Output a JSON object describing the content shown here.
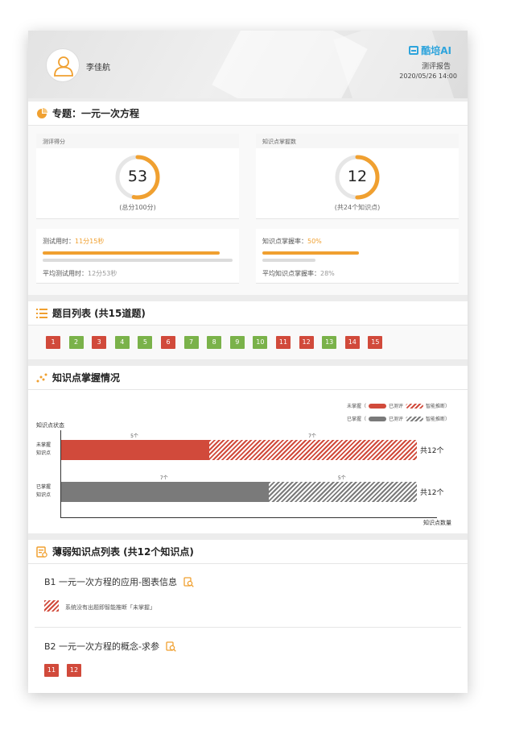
{
  "header": {
    "username": "李佳航",
    "brand": "酷培AI",
    "report_label": "测评报告",
    "report_time": "2020/05/26 14:00"
  },
  "topic": {
    "title": "专题：一元一次方程",
    "score_card": {
      "head": "测评得分",
      "value": "53",
      "sub": "(总分100分)",
      "fraction": 0.53
    },
    "kp_card": {
      "head": "知识点掌握数",
      "value": "12",
      "sub": "(共24个知识点)",
      "fraction": 0.5
    },
    "time": {
      "label": "测试用时：",
      "value": "11分15秒",
      "avg_label": "平均测试用时：",
      "avg_value": "12分53秒"
    },
    "rate": {
      "label": "知识点掌握率：",
      "value": "50%",
      "avg_label": "平均知识点掌握率：",
      "avg_value": "28%"
    }
  },
  "questions": {
    "title": "题目列表 (共15道题)",
    "items": [
      {
        "n": "1",
        "status": "red"
      },
      {
        "n": "2",
        "status": "green"
      },
      {
        "n": "3",
        "status": "red"
      },
      {
        "n": "4",
        "status": "green"
      },
      {
        "n": "5",
        "status": "green"
      },
      {
        "n": "6",
        "status": "red"
      },
      {
        "n": "7",
        "status": "green"
      },
      {
        "n": "8",
        "status": "green"
      },
      {
        "n": "9",
        "status": "green"
      },
      {
        "n": "10",
        "status": "green"
      },
      {
        "n": "11",
        "status": "red"
      },
      {
        "n": "12",
        "status": "red"
      },
      {
        "n": "13",
        "status": "green"
      },
      {
        "n": "14",
        "status": "red"
      },
      {
        "n": "15",
        "status": "red"
      }
    ]
  },
  "mastery": {
    "title": "知识点掌握情况",
    "legend": {
      "unmastered": "未掌握（",
      "mastered": "已掌握（",
      "tested": "已测评",
      "inferred": "智能推断）"
    },
    "y_axis_label": "知识点状态",
    "x_axis_label": "知识点数量",
    "rows": [
      {
        "label_line1": "未掌握",
        "label_line2": "知识点",
        "tested": 5,
        "inferred": 7,
        "tested_label": "5个",
        "inferred_label": "7个",
        "total": "共12个"
      },
      {
        "label_line1": "已掌握",
        "label_line2": "知识点",
        "tested": 7,
        "inferred": 5,
        "tested_label": "7个",
        "inferred_label": "5个",
        "total": "共12个"
      }
    ]
  },
  "weak": {
    "title": "薄弱知识点列表 (共12个知识点)",
    "items": [
      {
        "title": "B1 一元一次方程的应用-图表信息",
        "note": "系统没有出题即智能推断「未掌握」",
        "questions": []
      },
      {
        "title": "B2  一元一次方程的概念-求参",
        "note": "",
        "questions": [
          "11",
          "12"
        ]
      }
    ]
  },
  "colors": {
    "orange": "#f0a030",
    "red": "#d14a3b",
    "green": "#7ab24a",
    "gray": "#7a7a7a",
    "brand": "#2ea4dc"
  }
}
